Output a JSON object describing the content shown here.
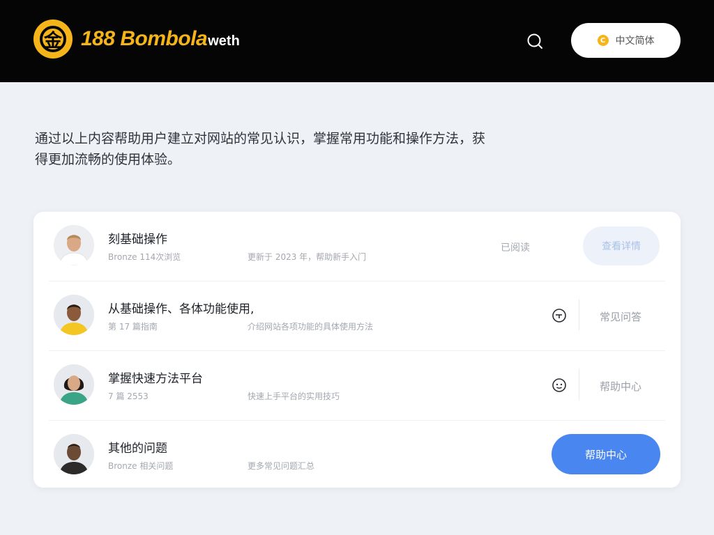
{
  "header": {
    "brand": "188 Bombola",
    "brand_suffix": "weth",
    "logo_glyph": "金",
    "action_button_label": "中文简体",
    "brand_color": "#f5b51a",
    "background": "#050505"
  },
  "intro": {
    "text": "通过以上内容帮助用户建立对网站的常见认识，掌握常用功能和操作方法，获得更加流畅的使用体验。"
  },
  "list": {
    "rows": [
      {
        "title": "刻基础操作",
        "meta_1": "Bronze 114次浏览",
        "meta_2": "更新于 2023 年，帮助新手入门",
        "status": "已阅读",
        "action": "查看详情",
        "action_style": "light"
      },
      {
        "title": "从基础操作、各体功能使用,",
        "meta_1": "第 17 篇指南",
        "meta_2": "介绍网站各项功能的具体使用方法",
        "action": "常见问答",
        "icon": "clock-icon"
      },
      {
        "title": "掌握快速方法平台",
        "meta_1": "7 篇 2553",
        "meta_2": "快速上手平台的实用技巧",
        "action": "帮助中心",
        "icon": "face-icon"
      },
      {
        "title": "其他的问题",
        "meta_1": "Bronze 相关问题",
        "meta_2": "更多常见问题汇总",
        "action": "帮助中心",
        "action_style": "primary"
      }
    ]
  },
  "colors": {
    "primary": "#4a86ef",
    "page_bg": "#eef1f6"
  }
}
